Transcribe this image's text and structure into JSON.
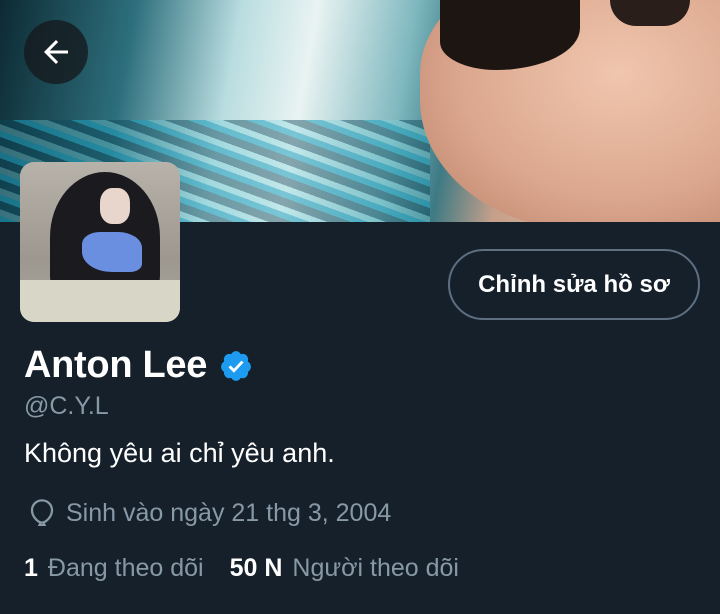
{
  "header": {
    "back_icon": "arrow-left-icon"
  },
  "profile": {
    "name": "Anton Lee",
    "verified_icon": "verified-badge-icon",
    "handle": "@C.Y.L",
    "bio": "Không yêu ai chỉ yêu anh.",
    "birth_icon": "balloon-icon",
    "birth_text": "Sinh vào ngày 21 thg 3, 2004",
    "edit_button_label": "Chỉnh sửa hồ sơ"
  },
  "stats": {
    "following_count": "1",
    "following_label": "Đang theo dõi",
    "followers_count": "50 N",
    "followers_label": "Người theo dõi"
  },
  "colors": {
    "background": "#15202b",
    "verified": "#1d9bf0",
    "secondary_text": "#8899a6",
    "button_border": "#5d6f80"
  }
}
